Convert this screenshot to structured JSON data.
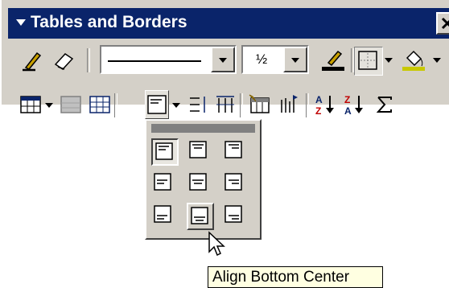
{
  "toolbar": {
    "title": "Tables and Borders",
    "line_weight": "½"
  },
  "icons": {
    "row1": [
      "draw-table-icon",
      "eraser-icon",
      "line-style-select",
      "line-weight-select",
      "border-color-icon",
      "outside-border-icon",
      "shading-color-icon"
    ],
    "row2": [
      "insert-table-icon",
      "merge-cells-icon",
      "split-cells-icon",
      "align-icon",
      "distribute-rows-icon",
      "distribute-columns-icon",
      "table-autoformat-icon",
      "change-text-direction-icon",
      "sort-ascending-icon",
      "sort-descending-icon",
      "autosum-icon"
    ]
  },
  "alignment_menu": {
    "cells": [
      "Align Top Left",
      "Align Top Center",
      "Align Top Right",
      "Align Center Left",
      "Align Center",
      "Align Center Right",
      "Align Bottom Left",
      "Align Bottom Center",
      "Align Bottom Right"
    ],
    "selected": "Align Top Left",
    "hovered": "Align Bottom Center"
  },
  "tooltip": {
    "text": "Align Bottom Center"
  },
  "colors": {
    "title_bar": "#0a246a",
    "face": "#d4d0c8",
    "tooltip_bg": "#ffffe1",
    "border_color": "#c8c800"
  }
}
